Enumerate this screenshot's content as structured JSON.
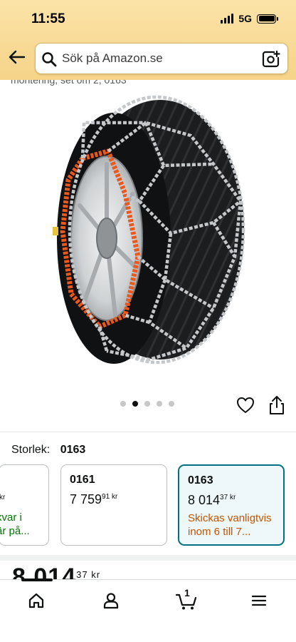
{
  "status_bar": {
    "time": "11:55",
    "network": "5G"
  },
  "search": {
    "placeholder": "Sök på Amazon.se"
  },
  "product": {
    "subtitle_partial": "montering, set om 2, 0163",
    "image_dots": {
      "count": 5,
      "active_index": 1
    }
  },
  "size": {
    "label": "Storlek:",
    "value": "0163",
    "options": [
      {
        "name": "",
        "price_whole": "",
        "price_fraction": "",
        "currency": "kr",
        "note_line1": "kvar i",
        "note_line2": "är på...",
        "note_color": "#007600"
      },
      {
        "name": "0161",
        "price_whole": "7 759",
        "price_fraction": "91",
        "currency": "kr",
        "note_line1": "",
        "note_line2": ""
      },
      {
        "name": "0163",
        "price_whole": "8 014",
        "price_fraction": "37",
        "currency": "kr",
        "note_line1": "Skickas vanligtvis",
        "note_line2": "inom 6 till 7...",
        "note_color": "#c45500",
        "selected": true
      }
    ]
  },
  "price": {
    "whole": "8 014",
    "fraction": "37",
    "currency": "kr"
  },
  "bottom_nav": {
    "items": [
      "home-icon",
      "account-icon",
      "cart-icon",
      "menu-icon"
    ],
    "cart_count": "1"
  },
  "colors": {
    "header": "#f6d489",
    "selected_border": "#007185",
    "orange_text": "#c45500",
    "green_text": "#007600",
    "chain_orange": "#e9581d"
  }
}
